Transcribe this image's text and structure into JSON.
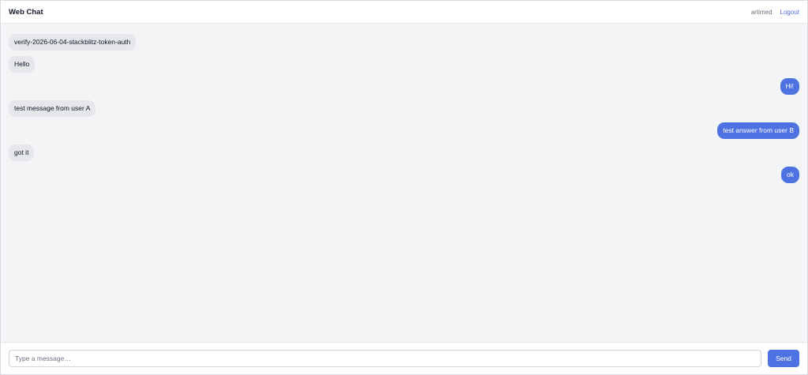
{
  "header": {
    "title": "Web Chat",
    "username": "artimed",
    "logout_label": "Logout"
  },
  "messages": [
    {
      "direction": "in",
      "text": "verify-2026-06-04-stackblitz-token-auth"
    },
    {
      "direction": "in",
      "text": "Hello"
    },
    {
      "direction": "out",
      "text": "Hi!"
    },
    {
      "direction": "in",
      "text": "test message from user A"
    },
    {
      "direction": "out",
      "text": "test answer from user B"
    },
    {
      "direction": "in",
      "text": "got it"
    },
    {
      "direction": "out",
      "text": "ok"
    }
  ],
  "composer": {
    "placeholder": "Type a message…",
    "value": "",
    "send_label": "Send"
  },
  "colors": {
    "accent": "#4f72e3",
    "incoming_bubble": "#e5e7eb",
    "chat_background": "#f3f4f6"
  }
}
